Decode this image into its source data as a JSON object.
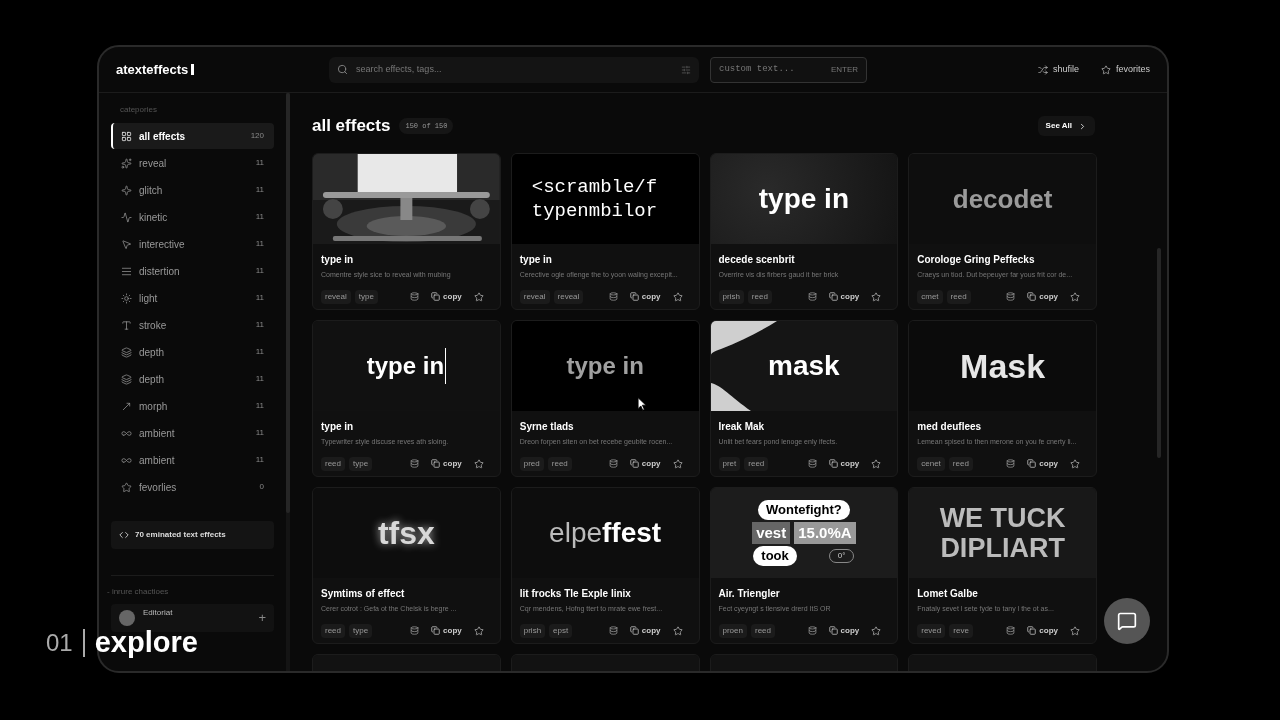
{
  "header": {
    "logo": "atexteffects",
    "search": {
      "placeholder": "search effects, tags..."
    },
    "custom_text": {
      "placeholder": "custom text...",
      "hint": "ENTER"
    },
    "actions": [
      {
        "kind": "shuffle",
        "label": "shufile"
      },
      {
        "kind": "star",
        "label": "fevorites"
      }
    ]
  },
  "sidebar": {
    "heading": "catepories",
    "items": [
      {
        "kind": "grid",
        "label": "all effects",
        "count": "120",
        "selected": true
      },
      {
        "kind": "sparkle",
        "label": "reveal",
        "count": "11",
        "selected": false
      },
      {
        "kind": "glitch",
        "label": "glitch",
        "count": "11",
        "selected": false
      },
      {
        "kind": "pulse",
        "label": "kinetic",
        "count": "11",
        "selected": false
      },
      {
        "kind": "pointer",
        "label": "interective",
        "count": "11",
        "selected": false
      },
      {
        "kind": "lines",
        "label": "distertion",
        "count": "11",
        "selected": false
      },
      {
        "kind": "sun",
        "label": "light",
        "count": "11",
        "selected": false
      },
      {
        "kind": "type",
        "label": "stroke",
        "count": "11",
        "selected": false
      },
      {
        "kind": "layers",
        "label": "depth",
        "count": "11",
        "selected": false
      },
      {
        "kind": "layers",
        "label": "depth",
        "count": "11",
        "selected": false
      },
      {
        "kind": "move",
        "label": "morph",
        "count": "11",
        "selected": false
      },
      {
        "kind": "infinity",
        "label": "ambient",
        "count": "11",
        "selected": false
      },
      {
        "kind": "infinity",
        "label": "ambient",
        "count": "11",
        "selected": false
      },
      {
        "kind": "star",
        "label": "fevorlies",
        "count": "0",
        "selected": false
      }
    ],
    "promo": "70 eminated text effects",
    "section": "- inrure chactioes",
    "user": {
      "name": "Editoriat",
      "add": "+"
    }
  },
  "main": {
    "title": "all effects",
    "badge": "150 of 150",
    "see_all": "See All",
    "cards": [
      {
        "title": "type in",
        "description": "Comentre style sice to reveal with mubing",
        "tags": [
          "reveal",
          "type"
        ],
        "copy": "copy"
      },
      {
        "preview": {
          "kind": "mono",
          "lines": [
            "<scramble/f",
            "typenmbilor"
          ]
        },
        "title": "type in",
        "description": "Cerective ogle oflenge the to yoon waling excepit...",
        "tags": [
          "reveal",
          "reveal"
        ],
        "copy": "copy"
      },
      {
        "preview": {
          "kind": "bold",
          "lines": [
            "type in"
          ]
        },
        "title": "decede scenbrit",
        "description": "Overrire vis dis firbers gaud it ber brick",
        "tags": [
          "prish",
          "reed"
        ],
        "copy": "copy"
      },
      {
        "preview": {
          "kind": "decode",
          "lines": [
            "decodet"
          ]
        },
        "title": "Corologe Gring Peffecks",
        "description": "Craeys un tiod. Dut bepeuyer far yous frit cor de...",
        "tags": [
          "cmet",
          "reed"
        ],
        "copy": "copy"
      },
      {
        "preview": {
          "kind": "cursor",
          "lines": [
            "type in"
          ]
        },
        "title": "type in",
        "description": "Typewriter style discuse reves ath sloing.",
        "tags": [
          "reed",
          "type"
        ],
        "copy": "copy"
      },
      {
        "preview": {
          "kind": "dim",
          "lines": [
            "type in"
          ]
        },
        "title": "Syrne tlads",
        "description": "Dreon forpen siten on bet recebe geubite rocen...",
        "tags": [
          "pred",
          "reed"
        ],
        "copy": "copy"
      },
      {
        "preview": {
          "kind": "mask",
          "lines": [
            "mask"
          ]
        },
        "title": "Ireak Mak",
        "description": "Unlit bet fears pond lenoge enly ifects.",
        "tags": [
          "pret",
          "reed"
        ],
        "copy": "copy"
      },
      {
        "preview": {
          "kind": "large",
          "lines": [
            "Mask"
          ]
        },
        "title": "med deuflees",
        "description": "Lemean spised to then merone on you fe cnerty li...",
        "tags": [
          "cenet",
          "reed"
        ],
        "copy": "copy"
      },
      {
        "preview": {
          "kind": "glow",
          "lines": [
            "tfsx"
          ]
        },
        "title": "Symtims of effect",
        "description": "Cerer cotrot : Gefa ot the Chelsk is begre ...",
        "tags": [
          "reed",
          "type"
        ],
        "copy": "copy"
      },
      {
        "preview": {
          "kind": "split",
          "lines": [
            "elpe**ffest**"
          ]
        },
        "title": "lit frocks Tle Exple linix",
        "description": "Cqr mendens, Hofng ttert to mrate ewe frest...",
        "tags": [
          "prish",
          "epst"
        ],
        "copy": "copy"
      },
      {
        "preview": {
          "kind": "bubbles",
          "lines": [
            "Wontefight?",
            "vest",
            "15.0%A",
            "took",
            "0°"
          ]
        },
        "title": "Air. Triengler",
        "description": "Fect cyeyngt s tlensive drerd ItS OR",
        "tags": [
          "proen",
          "reed"
        ],
        "copy": "copy"
      },
      {
        "preview": {
          "kind": "poster",
          "lines": [
            "WE TUCK",
            "DIPLIART"
          ]
        },
        "title": "Lomet Galbe",
        "description": "Fnataly sevet l sete fyde to tany l the ot as...",
        "tags": [
          "reved",
          "reve"
        ],
        "copy": "copy"
      },
      {
        "preview": {
          "kind": "blank"
        }
      },
      {
        "preview": {
          "kind": "blank"
        }
      },
      {
        "preview": {
          "kind": "blank"
        }
      },
      {
        "preview": {
          "kind": "blank"
        }
      }
    ]
  },
  "caption": {
    "index": "01",
    "title": "explore"
  }
}
